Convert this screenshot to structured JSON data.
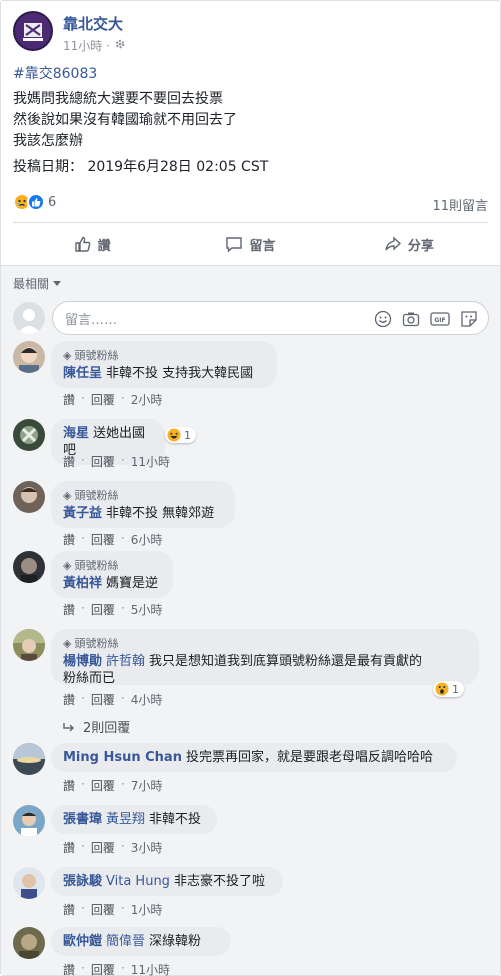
{
  "post": {
    "page_name": "靠北交大",
    "time": "11小時",
    "hashtag": "#靠交86083",
    "body_lines": [
      "我媽問我總統大選要不要回去投票",
      "然後說如果沒有韓國瑜就不用回去了",
      "我該怎麼辦"
    ],
    "date_line": "投稿日期： 2019年6月28日 02:05 CST",
    "reaction_count": "6",
    "comment_count": "11則留言"
  },
  "actions": {
    "like": "讚",
    "comment": "留言",
    "share": "分享"
  },
  "sort_label": "最相關",
  "comment_placeholder": "留言……",
  "comments": [
    {
      "badge": "頭號粉絲",
      "author": "陳任呈",
      "tag": "",
      "text": "非韓不投 支持我大韓民國",
      "like": "讚",
      "reply": "回覆",
      "time": "2小時"
    },
    {
      "badge": "",
      "author": "海星",
      "tag": "",
      "text": "送她出國吧",
      "like": "讚",
      "reply": "回覆",
      "time": "11小時",
      "reaction_count": "1"
    },
    {
      "badge": "頭號粉絲",
      "author": "黃子益",
      "tag": "",
      "text": "非韓不投 無韓郊遊",
      "like": "讚",
      "reply": "回覆",
      "time": "6小時"
    },
    {
      "badge": "頭號粉絲",
      "author": "黃柏祥",
      "tag": "",
      "text": "媽寶是逆",
      "like": "讚",
      "reply": "回覆",
      "time": "5小時"
    },
    {
      "badge": "頭號粉絲",
      "author": "楊博勛",
      "tag": "許哲翰",
      "text_line1": "我只是想知道我到底算頭號粉絲還是最有貢獻的",
      "text_line2": "粉絲而已",
      "like": "讚",
      "reply": "回覆",
      "time": "4小時",
      "reaction_count": "1"
    },
    {
      "badge": "",
      "author": "Ming Hsun Chan",
      "tag": "",
      "text": "投完票再回家，就是要跟老母唱反調哈哈哈",
      "like": "讚",
      "reply": "回覆",
      "time": "7小時"
    },
    {
      "badge": "",
      "author": "張書瑋",
      "tag": "黃昱翔",
      "text": "非韓不投",
      "like": "讚",
      "reply": "回覆",
      "time": "3小時"
    },
    {
      "badge": "",
      "author": "張詠駿",
      "tag": "Vita Hung",
      "text": "非志豪不投了啦",
      "like": "讚",
      "reply": "回覆",
      "time": "1小時"
    },
    {
      "badge": "",
      "author": "歐仲鎧",
      "tag": "簡偉晉",
      "text": "深綠韓粉",
      "like": "讚",
      "reply": "回覆",
      "time": "11小時"
    }
  ],
  "replies_label": "2則回覆",
  "colors": {
    "link": "#385898",
    "bubble": "#e9ebee",
    "like_blue": "#1877f2",
    "sad_yellow": "#f7b125"
  }
}
